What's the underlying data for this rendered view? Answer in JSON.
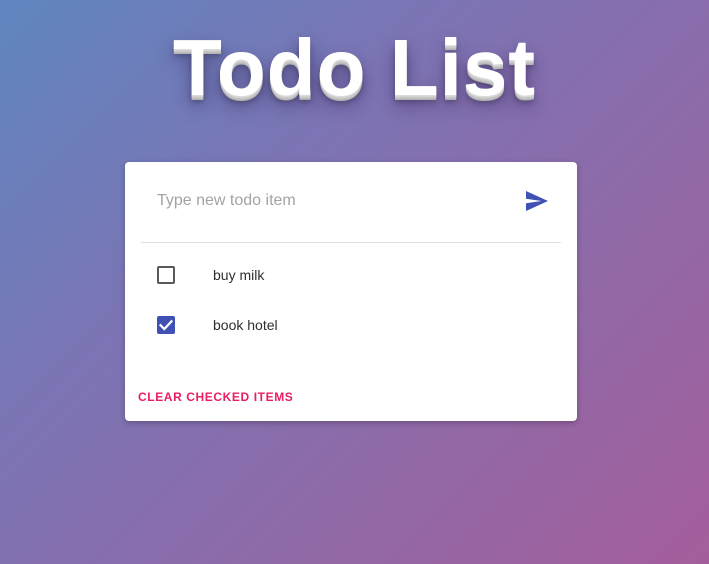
{
  "app": {
    "title": "Todo List"
  },
  "input": {
    "placeholder": "Type new todo item",
    "value": "",
    "submit_icon": "send-icon"
  },
  "todos": [
    {
      "label": "buy milk",
      "checked": false
    },
    {
      "label": "book hotel",
      "checked": true
    }
  ],
  "actions": {
    "clear_label": "CLEAR CHECKED ITEMS"
  },
  "colors": {
    "primary": "#3f51b5",
    "accent": "#e91e63",
    "background_start": "#5f86c0",
    "background_end": "#a45d9b"
  }
}
